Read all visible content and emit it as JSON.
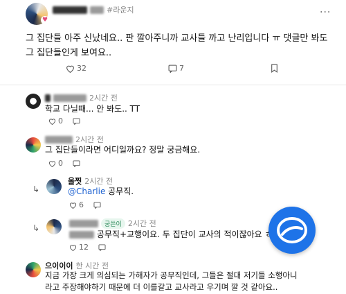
{
  "post": {
    "author_suffix": "#라운지",
    "text": "그 집단들 아주 신났네요.. 판 깔아주니까 교사들 까고 난리입니다 ㅠ 댓글만 봐도 그 집단들인게 보여요..",
    "likes": "32",
    "comments": "7",
    "more": "···"
  },
  "comments": [
    {
      "time": "2시간 전",
      "text": "학교 다닐때... 안 봐도.. TT",
      "likes": "0"
    },
    {
      "time": "2시간 전",
      "text": "그 집단들이라면 어디일까요? 정말 궁금해요.",
      "likes": "0"
    },
    {
      "author": "올찟",
      "time": "2시간 전",
      "mention": "@Charlie",
      "text": " 공무직.",
      "likes": "6"
    },
    {
      "badge": "궁쓴이",
      "time": "2시간 전",
      "text": "공무직+교행이요. 두 집단이 교사의 적이잖아요 ㅎ",
      "likes": "12"
    },
    {
      "author": "으이이이",
      "time": "한 시간 전",
      "text_line1": "지금 가장 크게 의심되는 가해자가 공무직인데, 그들은 절대 저기들 소행아니",
      "text_line2": "라고 주장해야하기 때문에 더 이를갈고 교사라고 우기며 깔 것 같아요.."
    }
  ],
  "icons": {
    "heart": "heart-icon",
    "comment": "comment-icon",
    "bookmark": "bookmark-icon",
    "reply": "reply-arrow-icon",
    "fab": "write-fab-icon"
  },
  "colors": {
    "accent": "#1e73e8",
    "mention": "#1a5fd0"
  }
}
